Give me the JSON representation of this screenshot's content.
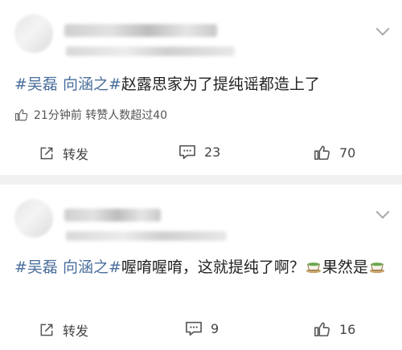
{
  "posts": [
    {
      "topic": "#吴磊 向涵之#",
      "text": "赵露思家为了提纯谣都造上了",
      "repost_info": "21分钟前 转赞人数超过40",
      "actions": {
        "repost_label": "转发",
        "comments": "23",
        "likes": "70"
      }
    },
    {
      "topic": "#吴磊 向涵之#",
      "text_part1": "喔唷喔唷，这就提纯了啊？",
      "text_part2": "果然是",
      "actions": {
        "repost_label": "转发",
        "comments": "9",
        "likes": "16"
      }
    }
  ],
  "icons": {
    "tea": "tea-emoji-icon",
    "like": "thumbs-up-icon",
    "comment": "comment-icon",
    "repost": "repost-icon",
    "more": "chevron-down-icon"
  },
  "colors": {
    "topic": "#4a6e9c",
    "separator": "#f1f1f1"
  }
}
